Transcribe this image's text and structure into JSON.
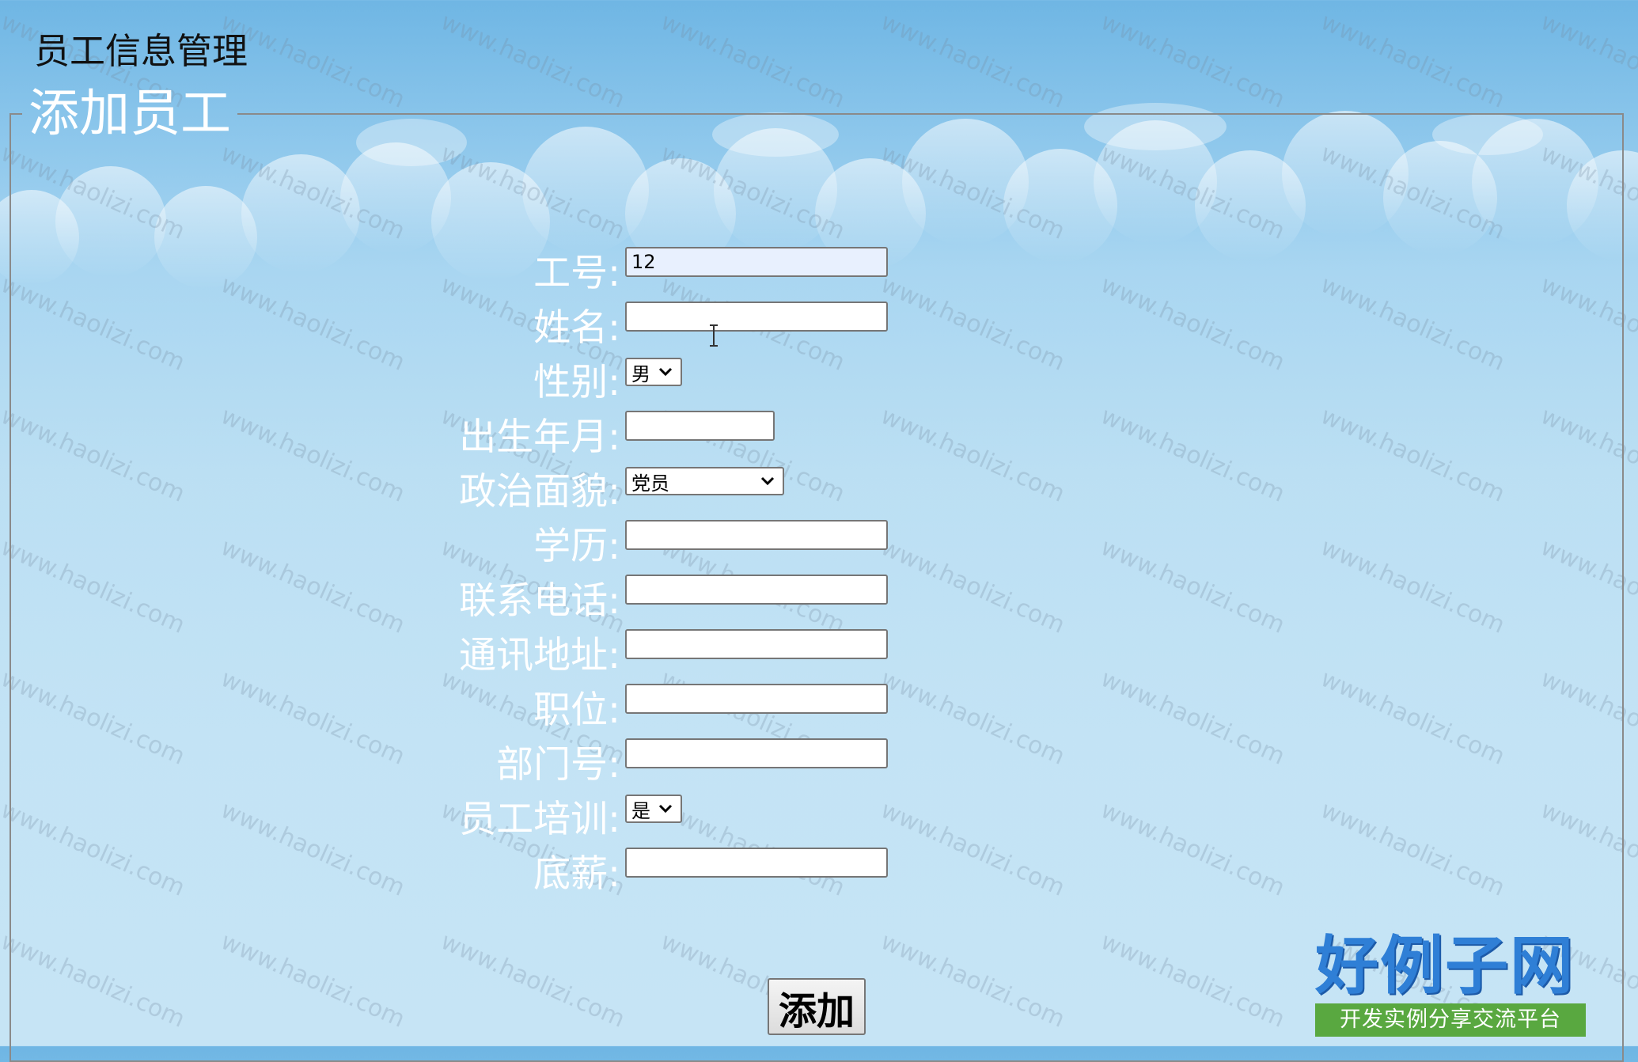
{
  "app": {
    "title": "员工信息管理"
  },
  "panel": {
    "legend": "添加员工"
  },
  "form": {
    "fields": {
      "employee_id": {
        "label": "工号:",
        "value": "12"
      },
      "name": {
        "label": "姓名:",
        "value": ""
      },
      "gender": {
        "label": "性别:",
        "value": "男"
      },
      "birth_month": {
        "label": "出生年月:",
        "value": ""
      },
      "political_status": {
        "label": "政治面貌:",
        "value": "党员"
      },
      "education": {
        "label": "学历:",
        "value": ""
      },
      "phone": {
        "label": "联系电话:",
        "value": ""
      },
      "address": {
        "label": "通讯地址:",
        "value": ""
      },
      "position": {
        "label": "职位:",
        "value": ""
      },
      "department_no": {
        "label": "部门号:",
        "value": ""
      },
      "training": {
        "label": "员工培训:",
        "value": "是"
      },
      "base_salary": {
        "label": "底薪:",
        "value": ""
      }
    },
    "submit_label": "添加"
  },
  "watermark": {
    "text": "www.haolizi.com"
  },
  "brand": {
    "name": "好例子网",
    "tagline": "开发实例分享交流平台"
  },
  "colors": {
    "label_text": "#ffffff",
    "background_top": "#6fb6e4",
    "background_bottom": "#c6e4f5",
    "brand_blue": "#2f7fd6",
    "brand_green": "#59a840"
  },
  "icons": {
    "select_arrow": "chevron-down-icon",
    "cursor": "text-cursor-icon"
  }
}
